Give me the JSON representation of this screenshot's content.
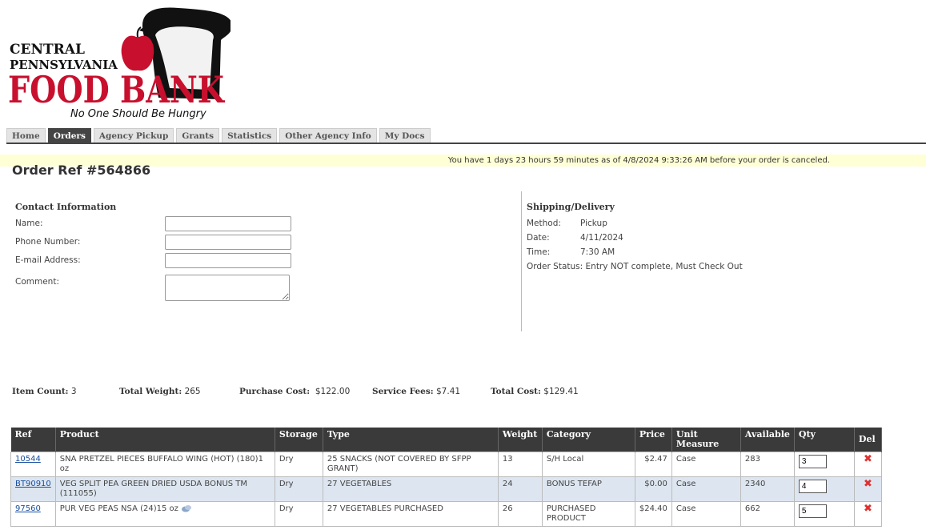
{
  "logo": {
    "line1": "CENTRAL",
    "line2": "PENNSYLVANIA",
    "line3": "FOOD BANK",
    "tagline": "No One Should Be Hungry",
    "colors": {
      "red": "#c8102e",
      "black": "#111111"
    }
  },
  "tabs": [
    {
      "label": "Home",
      "active": false
    },
    {
      "label": "Orders",
      "active": true
    },
    {
      "label": "Agency Pickup",
      "active": false
    },
    {
      "label": "Grants",
      "active": false
    },
    {
      "label": "Statistics",
      "active": false
    },
    {
      "label": "Other Agency Info",
      "active": false
    },
    {
      "label": "My Docs",
      "active": false
    }
  ],
  "notice": "You have 1 days 23 hours 59 minutes as of 4/8/2024 9:33:26 AM before your order is canceled.",
  "order_title": "Order Ref #564866",
  "contact": {
    "title": "Contact Information",
    "name_label": "Name:",
    "name_value": "",
    "phone_label": "Phone Number:",
    "phone_value": "",
    "email_label": "E-mail Address:",
    "email_value": "",
    "comment_label": "Comment:",
    "comment_value": ""
  },
  "shipping": {
    "title": "Shipping/Delivery",
    "method_label": "Method:",
    "method": "Pickup",
    "date_label": "Date:",
    "date": "4/11/2024",
    "time_label": "Time:",
    "time": "7:30 AM",
    "status_label": "Order Status:",
    "status": "Entry NOT complete, Must Check Out"
  },
  "totals": {
    "item_count_label": "Item Count:",
    "item_count": "3",
    "total_weight_label": "Total Weight:",
    "total_weight": "265",
    "purchase_cost_label": "Purchase Cost:",
    "purchase_cost": "$122.00",
    "service_fees_label": "Service Fees:",
    "service_fees": "$7.41",
    "total_cost_label": "Total Cost:",
    "total_cost": "$129.41"
  },
  "table": {
    "headers": {
      "ref": "Ref",
      "product": "Product",
      "storage": "Storage",
      "type": "Type",
      "weight": "Weight",
      "category": "Category",
      "price": "Price",
      "unit": "Unit Measure",
      "available": "Available",
      "qty": "Qty",
      "del": "Del"
    },
    "rows": [
      {
        "ref": "10544",
        "product": "SNA PRETZEL PIECES BUFFALO WING (HOT) (180)1 oz",
        "storage": "Dry",
        "type": "25 SNACKS (NOT COVERED BY SFPP GRANT)",
        "weight": "13",
        "category": "S/H Local",
        "price": "$2.47",
        "unit": "Case",
        "available": "283",
        "qty": "3"
      },
      {
        "ref": "BT90910",
        "product": "VEG SPLIT PEA GREEN DRIED USDA BONUS TM (111055)",
        "storage": "Dry",
        "type": "27 VEGETABLES",
        "weight": "24",
        "category": "BONUS TEFAP",
        "price": "$0.00",
        "unit": "Case",
        "available": "2340",
        "qty": "4"
      },
      {
        "ref": "97560",
        "product": "PUR VEG PEAS NSA (24)15 oz",
        "storage": "Dry",
        "type": "27 VEGETABLES PURCHASED",
        "weight": "26",
        "category": "PURCHASED PRODUCT",
        "price": "$24.40",
        "unit": "Case",
        "available": "662",
        "qty": "5"
      }
    ],
    "delete_glyph": "✖"
  }
}
